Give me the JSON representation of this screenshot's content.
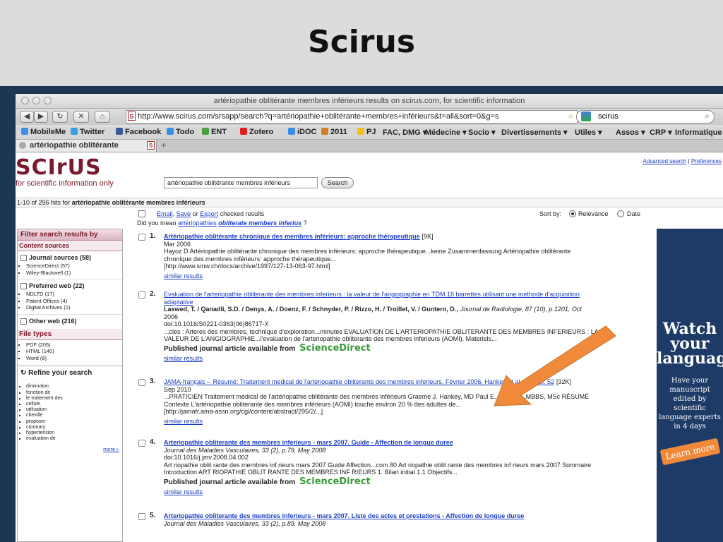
{
  "slide": {
    "title": "Scirus"
  },
  "window": {
    "title": "artériopathie oblitérante membres inférieurs results on scirus.com, for scientific information",
    "url": "http://www.scirus.com/srsapp/search?q=artériopathie+oblitérante+membres+inférieurs&t=all&sort=0&g=s",
    "search_value": "scirus",
    "url_icon": "S",
    "nav": {
      "back": "◀",
      "forward": "▶",
      "reload": "↻",
      "stop": "✕",
      "home": "⌂"
    }
  },
  "bookmarks": [
    "MobileMe",
    "Twitter",
    "Facebook",
    "Todo",
    "ENT",
    "Zotero",
    "iDOC",
    "2011",
    "PJ",
    "FAC, DMG ▾",
    "Médecine ▾",
    "Socio ▾",
    "Divertissements ▾",
    "Utiles ▾",
    "Assos ▾",
    "CRP ▾",
    "Informatique ▾"
  ],
  "tab": {
    "label": "artériopathie oblitérante membre...",
    "new_tab": "+"
  },
  "page": {
    "logo": "SCIrUS",
    "tagline": "for scientific information only",
    "query": "artériopathie oblitérante membres inférieurs",
    "search_button": "Search",
    "advanced_search": "Advanced search",
    "separator": "|",
    "preferences": "Preferences",
    "hits_prefix": "1-10 of 296 hits for",
    "hits_query": "artériopathie oblitérante membres inférieurs",
    "email": "Email",
    "comma": ",",
    "save": "Save",
    "or": "or",
    "export": "Export",
    "checked_results": "checked results",
    "sort_by": "Sort by:",
    "relevance": "Relevance",
    "date": "Date",
    "did_you_mean": "Did you mean",
    "suggestion_1": "artériopathies",
    "suggestion_2": "obliterate members inferius",
    "question_mark": "?"
  },
  "sidebar": {
    "filter_header": "Filter search results by",
    "content_sources": "Content sources",
    "journal_sources": "Journal sources (58)",
    "journal_items": [
      "ScienceDirect (57)",
      "Wiley-Blackwell (1)"
    ],
    "preferred_web": "Preferred web (22)",
    "preferred_items": [
      "NDLTD (17)",
      "Patent Offices (4)",
      "Digital Archives (1)"
    ],
    "other_web": "Other web (216)",
    "file_types": "File types",
    "file_items": [
      "PDF (205)",
      "HTML (140)",
      "Word (8)"
    ],
    "refine_header": "Refine your search",
    "refine_items": [
      "diminution",
      "fonction de",
      "le traitement des",
      "cellule",
      "utilisation",
      "cheville",
      "proposer",
      "coronary",
      "hypertension",
      "evaluation de"
    ],
    "more": "more ▹"
  },
  "results": [
    {
      "num": "1.",
      "title": "Artériopathie oblitérante chronique des membres inférieurs: approche thérapeutique",
      "size": "[9K]",
      "date": "Mar 2006",
      "authors_snippet": "Hayoz D Artériopathie oblitérante chronique des membres inférieurs: approche thérapeutique...keine Zusammenfassung Artériopathie oblitérante",
      "snippet2": "chronique des membres inférieurs: approche thérapeutique...",
      "url": "[http://www.smw.ch/docs/archive/1997/127-13-063-97.html]",
      "similar": "similar results"
    },
    {
      "num": "2.",
      "title": "Evaluation de l'arteriopathie obliterante des membres inferieurs : la valeur de l'angiographie en TDM 16 barrettes utilisant une methode d'acquisition",
      "title2": "adaptative",
      "authors": "Laswed, T. / Qanadli, S.D. / Denys, A. / Doenz, F. / Schnyder, P. / Rizzo, H. / Troillet, V. / Guntern, D.,",
      "journal": "Journal de Radiologie, 87 (10), p.1201, Oct",
      "year": "2006",
      "doi": "doi:10.1016/S0221-0363(06)86717-X",
      "snippet": "...cles : Arteres des membres, technique d'exploration...minutes EVALUATION DE L'ARTERIOPATHIE OBLITERANTE DES MEMBRES INFERIEURS : LA",
      "snippet2": "VALEUR DE L'ANGIOGRAPHIE...l'evaluation de l'arteriopathie obliterante des membres inferieurs (AOMI). Materiels...",
      "published": "Published journal article available from",
      "source": "ScienceDirect",
      "similar": "similar results"
    },
    {
      "num": "3.",
      "title": "JAMA-français -- Résumé: Traitement medical de l'arteriopathie obliterante des membres inferieurs, Février 2006, Hankey et al. 295 (2): 52",
      "size": "[32K]",
      "date": "Sep 2010",
      "snippet": "...PRATICIEN Traitement médical de l'artériopathie oblitérante des membres inférieurs Graeme J. Hankey, MD Paul E. Norman...MBBS, MSc RÉSUMÉ",
      "snippet2": "Contexte L'artériopathie oblitérante des membres inférieurs (AOMI) touche environ 20 % des adultes de...",
      "url": "[http://jamafr.ama-assn.org/cgi/content/abstract/295/2/...]",
      "similar": "similar results"
    },
    {
      "num": "4.",
      "title": "Arteriopathie obliterante des membres inferieurs - mars 2007. Guide - Affection de longue duree",
      "journal": "Journal des Maladies Vasculaires, 33 (2), p.79, May 2008",
      "doi": "doi:10.1016/j.jmv.2008.04.002",
      "snippet": "Art riopathie oblit rante des membres inf rieurs mars 2007 Guide Affection...com 80 Art riopathie oblit rante des membres inf rieurs mars 2007 Sommaire",
      "snippet2": "Introduction ART RIOPATHIE OBLIT RANTE DES MEMBRES INF RIEURS 1. Bilan initial 1.1 Objectifs...",
      "published": "Published journal article available from",
      "source": "ScienceDirect",
      "similar": "similar results"
    },
    {
      "num": "5.",
      "title": "Arteriopathie obliterante des membres inferieurs - mars 2007. Liste des actes et prestations - Affection de longue duree",
      "journal": "Journal des Maladies Vasculaires, 33 (2), p.89, May 2008"
    }
  ],
  "ad": {
    "headline": "Watch your language!",
    "body": "Have your manuscript edited by scientific language experts in 4 days",
    "button": "Learn more"
  },
  "colors": {
    "brand": "#7a1a2a",
    "link": "#1a3cc4",
    "arrow": "#f08a3a",
    "frame": "#1d3654"
  }
}
